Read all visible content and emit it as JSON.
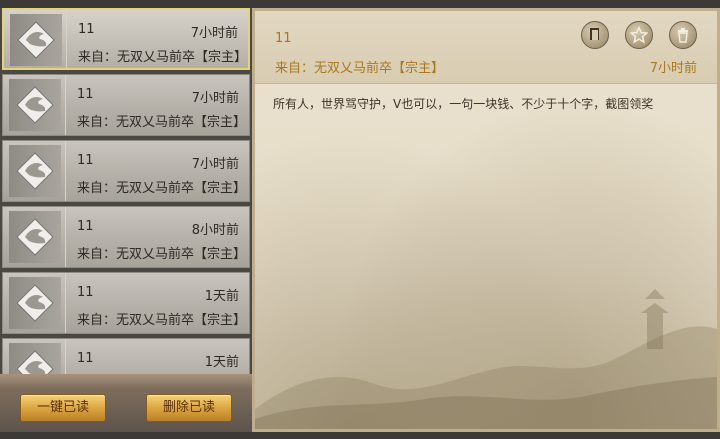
{
  "mail_list": {
    "items": [
      {
        "title": "11",
        "time": "7小时前",
        "from": "来自：无双乂马前卒【宗主】",
        "selected": true
      },
      {
        "title": "11",
        "time": "7小时前",
        "from": "来自：无双乂马前卒【宗主】",
        "selected": false
      },
      {
        "title": "11",
        "time": "7小时前",
        "from": "来自：无双乂马前卒【宗主】",
        "selected": false
      },
      {
        "title": "11",
        "time": "8小时前",
        "from": "来自：无双乂马前卒【宗主】",
        "selected": false
      },
      {
        "title": "11",
        "time": "1天前",
        "from": "来自：无双乂马前卒【宗主】",
        "selected": false
      },
      {
        "title": "11",
        "time": "1天前",
        "from": "",
        "selected": false
      }
    ],
    "mark_all_read_label": "一键已读",
    "delete_read_label": "删除已读"
  },
  "detail": {
    "title": "11",
    "from": "来自：无双乂马前卒【宗主】",
    "time": "7小时前",
    "body": "所有人，世界骂守护，V也可以，一句一块钱、不少于十个字，截图领奖",
    "icons": [
      "copy-icon",
      "star-icon",
      "trash-icon"
    ]
  },
  "colors": {
    "accent_gold": "#a9771e",
    "selected_border": "#e6d27a",
    "button_gold": "#d9a23d"
  }
}
